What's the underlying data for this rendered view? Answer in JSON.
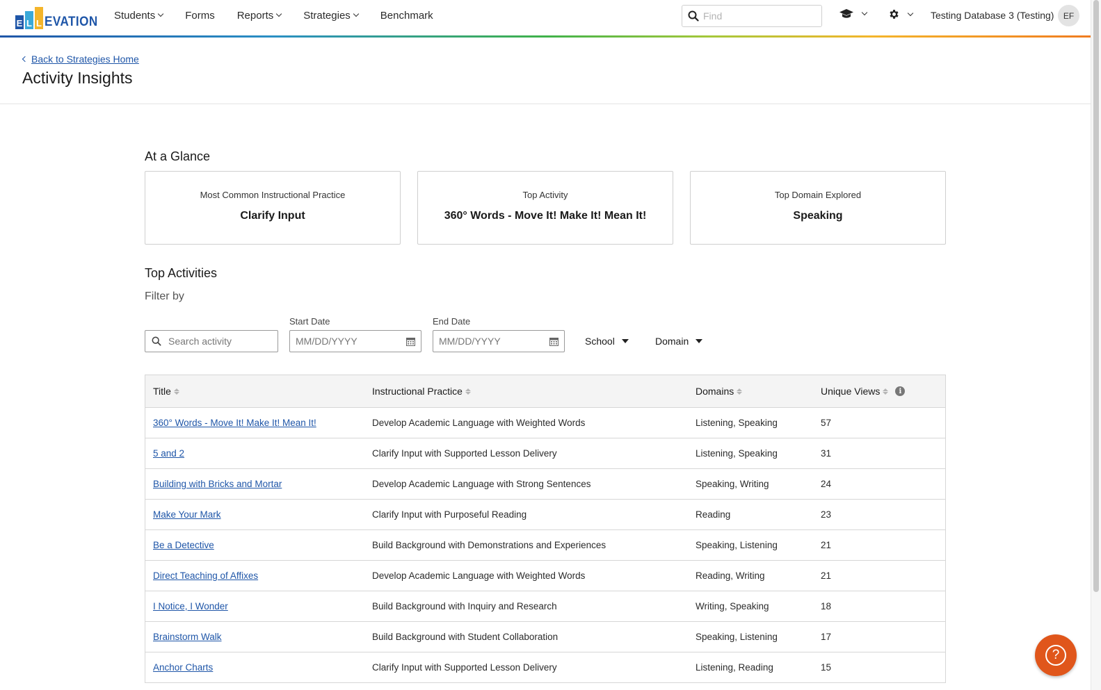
{
  "brand": {
    "logo_letters": [
      "E",
      "L",
      "L"
    ],
    "logo_word": "EVATION"
  },
  "nav": {
    "items": [
      {
        "label": "Students",
        "dropdown": true
      },
      {
        "label": "Forms",
        "dropdown": false
      },
      {
        "label": "Reports",
        "dropdown": true
      },
      {
        "label": "Strategies",
        "dropdown": true
      },
      {
        "label": "Benchmark",
        "dropdown": false
      }
    ],
    "find_placeholder": "Find",
    "database_name": "Testing Database 3 (Testing)",
    "avatar_initials": "EF"
  },
  "header": {
    "back_link": "Back to Strategies Home",
    "title": "Activity Insights"
  },
  "glance": {
    "heading": "At a Glance",
    "cards": [
      {
        "label": "Most Common Instructional Practice",
        "value": "Clarify Input"
      },
      {
        "label": "Top Activity",
        "value": "360° Words - Move It! Make It! Mean It!"
      },
      {
        "label": "Top Domain Explored",
        "value": "Speaking"
      }
    ]
  },
  "top_activities": {
    "heading": "Top Activities",
    "filter_by": "Filter by",
    "search_placeholder": "Search activity",
    "start_date_label": "Start Date",
    "end_date_label": "End Date",
    "date_placeholder": "MM/DD/YYYY",
    "school_label": "School",
    "domain_label": "Domain"
  },
  "table": {
    "columns": [
      "Title",
      "Instructional Practice",
      "Domains",
      "Unique Views"
    ],
    "rows": [
      {
        "title": "360° Words - Move It! Make It! Mean It!",
        "practice": "Develop Academic Language with Weighted Words",
        "domains": "Listening, Speaking",
        "views": "57"
      },
      {
        "title": "5 and 2",
        "practice": "Clarify Input with Supported Lesson Delivery",
        "domains": "Listening, Speaking",
        "views": "31"
      },
      {
        "title": "Building with Bricks and Mortar",
        "practice": "Develop Academic Language with Strong Sentences",
        "domains": "Speaking, Writing",
        "views": "24"
      },
      {
        "title": "Make Your Mark",
        "practice": "Clarify Input with Purposeful Reading",
        "domains": "Reading",
        "views": "23"
      },
      {
        "title": "Be a Detective",
        "practice": "Build Background with Demonstrations and Experiences",
        "domains": "Speaking, Listening",
        "views": "21"
      },
      {
        "title": "Direct Teaching of Affixes",
        "practice": "Develop Academic Language with Weighted Words",
        "domains": "Reading, Writing",
        "views": "21"
      },
      {
        "title": "I Notice, I Wonder",
        "practice": "Build Background with Inquiry and Research",
        "domains": "Writing, Speaking",
        "views": "18"
      },
      {
        "title": "Brainstorm Walk",
        "practice": "Build Background with Student Collaboration",
        "domains": "Speaking, Listening",
        "views": "17"
      },
      {
        "title": "Anchor Charts",
        "practice": "Clarify Input with Supported Lesson Delivery",
        "domains": "Listening, Reading",
        "views": "15"
      }
    ]
  },
  "help": {
    "glyph": "?"
  },
  "colors": {
    "brand_blue": "#1f56a8",
    "help_orange": "#e0561b"
  }
}
